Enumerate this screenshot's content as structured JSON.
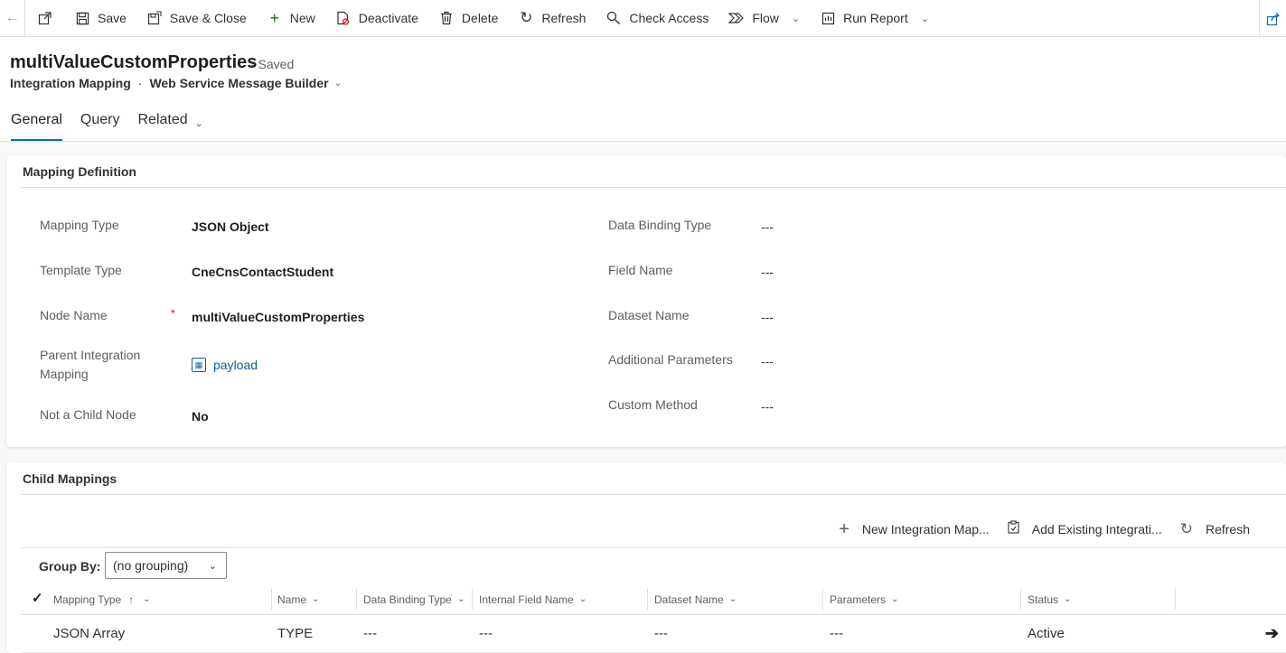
{
  "commands": {
    "save": "Save",
    "save_close": "Save & Close",
    "new": "New",
    "deactivate": "Deactivate",
    "delete": "Delete",
    "refresh": "Refresh",
    "check_access": "Check Access",
    "flow": "Flow",
    "run_report": "Run Report"
  },
  "header": {
    "title": "multiValueCustomProperties",
    "saved_status": "- Saved",
    "entity": "Integration Mapping",
    "form_selector": "Web Service Message Builder"
  },
  "tabs": [
    "General",
    "Query",
    "Related"
  ],
  "mapping_definition": {
    "title": "Mapping Definition",
    "left_fields": [
      {
        "label": "Mapping Type",
        "value": "JSON Object"
      },
      {
        "label": "Template Type",
        "value": "CneCnsContactStudent"
      },
      {
        "label": "Node Name",
        "value": "multiValueCustomProperties",
        "required_marker": "*"
      },
      {
        "label": "Parent Integration Mapping",
        "value": "payload"
      },
      {
        "label": "Not a Child Node",
        "value": "No"
      }
    ],
    "right_fields": [
      {
        "label": "Data Binding Type",
        "value": "---"
      },
      {
        "label": "Field Name",
        "value": "---"
      },
      {
        "label": "Dataset Name",
        "value": "---"
      },
      {
        "label": "Additional Parameters",
        "value": "---"
      },
      {
        "label": "Custom Method",
        "value": "---"
      }
    ]
  },
  "child_mappings": {
    "title": "Child Mappings",
    "new_label": "New Integration Map...",
    "add_existing_label": "Add Existing Integrati...",
    "refresh_label": "Refresh",
    "group_by_label": "Group By:",
    "group_by_value": "(no grouping)",
    "columns": [
      "Mapping Type",
      "Name",
      "Data Binding Type",
      "Internal Field Name",
      "Dataset Name",
      "Parameters",
      "Status"
    ],
    "sort_indicator": "↑",
    "rows": [
      {
        "mapping_type": "JSON Array",
        "name": "TYPE",
        "data_binding_type": "---",
        "internal_field_name": "---",
        "dataset_name": "---",
        "parameters": "---",
        "status": "Active"
      }
    ]
  }
}
